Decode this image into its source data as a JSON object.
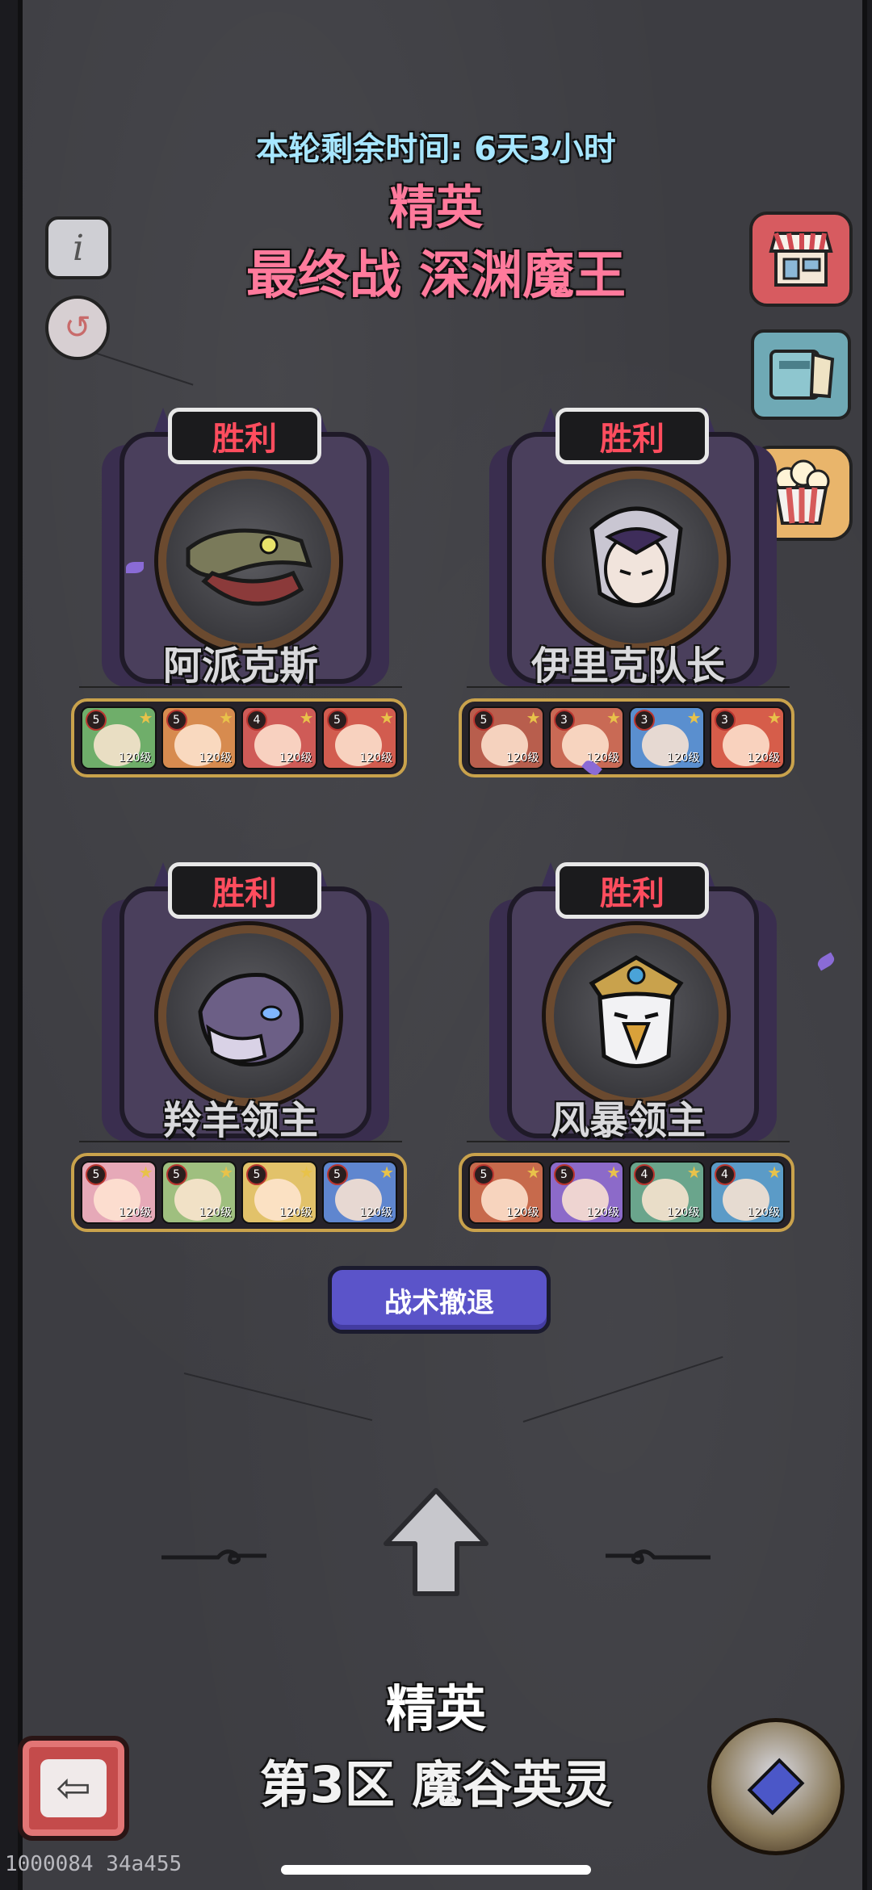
{
  "header": {
    "timer": "本轮剩余时间: 6天3小时",
    "tier": "精英",
    "final_battle": "最终战 深渊魔王"
  },
  "side_buttons": {
    "info_icon": "i",
    "refresh_icon": "↺"
  },
  "bosses": [
    {
      "status": "胜利",
      "name": "阿派克斯",
      "icon": "crocodile",
      "team": [
        {
          "stars": "5",
          "level": "120级",
          "color": "#6fae6a"
        },
        {
          "stars": "5",
          "level": "120级",
          "color": "#d78b4f"
        },
        {
          "stars": "4",
          "level": "120级",
          "color": "#cf5b57"
        },
        {
          "stars": "5",
          "level": "120级",
          "color": "#d25c4f"
        }
      ]
    },
    {
      "status": "胜利",
      "name": "伊里克队长",
      "icon": "elf-captain",
      "team": [
        {
          "stars": "5",
          "level": "120级",
          "color": "#b85e4d"
        },
        {
          "stars": "3",
          "level": "120级",
          "color": "#c96a55"
        },
        {
          "stars": "3",
          "level": "120级",
          "color": "#5a8fcf"
        },
        {
          "stars": "3",
          "level": "120级",
          "color": "#d65d4a"
        }
      ]
    },
    {
      "status": "胜利",
      "name": "羚羊领主",
      "icon": "antelope-lord",
      "team": [
        {
          "stars": "5",
          "level": "120级",
          "color": "#e6a9b8"
        },
        {
          "stars": "5",
          "level": "120级",
          "color": "#9fbf7f"
        },
        {
          "stars": "5",
          "level": "120级",
          "color": "#e2c26a"
        },
        {
          "stars": "5",
          "level": "120级",
          "color": "#5f86cf"
        }
      ]
    },
    {
      "status": "胜利",
      "name": "风暴领主",
      "icon": "storm-lord-eagle",
      "team": [
        {
          "stars": "5",
          "level": "120级",
          "color": "#c76a4c"
        },
        {
          "stars": "5",
          "level": "120级",
          "color": "#8c6ac9"
        },
        {
          "stars": "4",
          "level": "120级",
          "color": "#6aa58c"
        },
        {
          "stars": "4",
          "level": "120级",
          "color": "#5b9bc7"
        }
      ]
    }
  ],
  "retreat_button": "战术撤退",
  "footer": {
    "tier": "精英",
    "area": "第3区 魔谷英灵",
    "back_icon": "⇦",
    "build_id": "1000084 34a455"
  }
}
